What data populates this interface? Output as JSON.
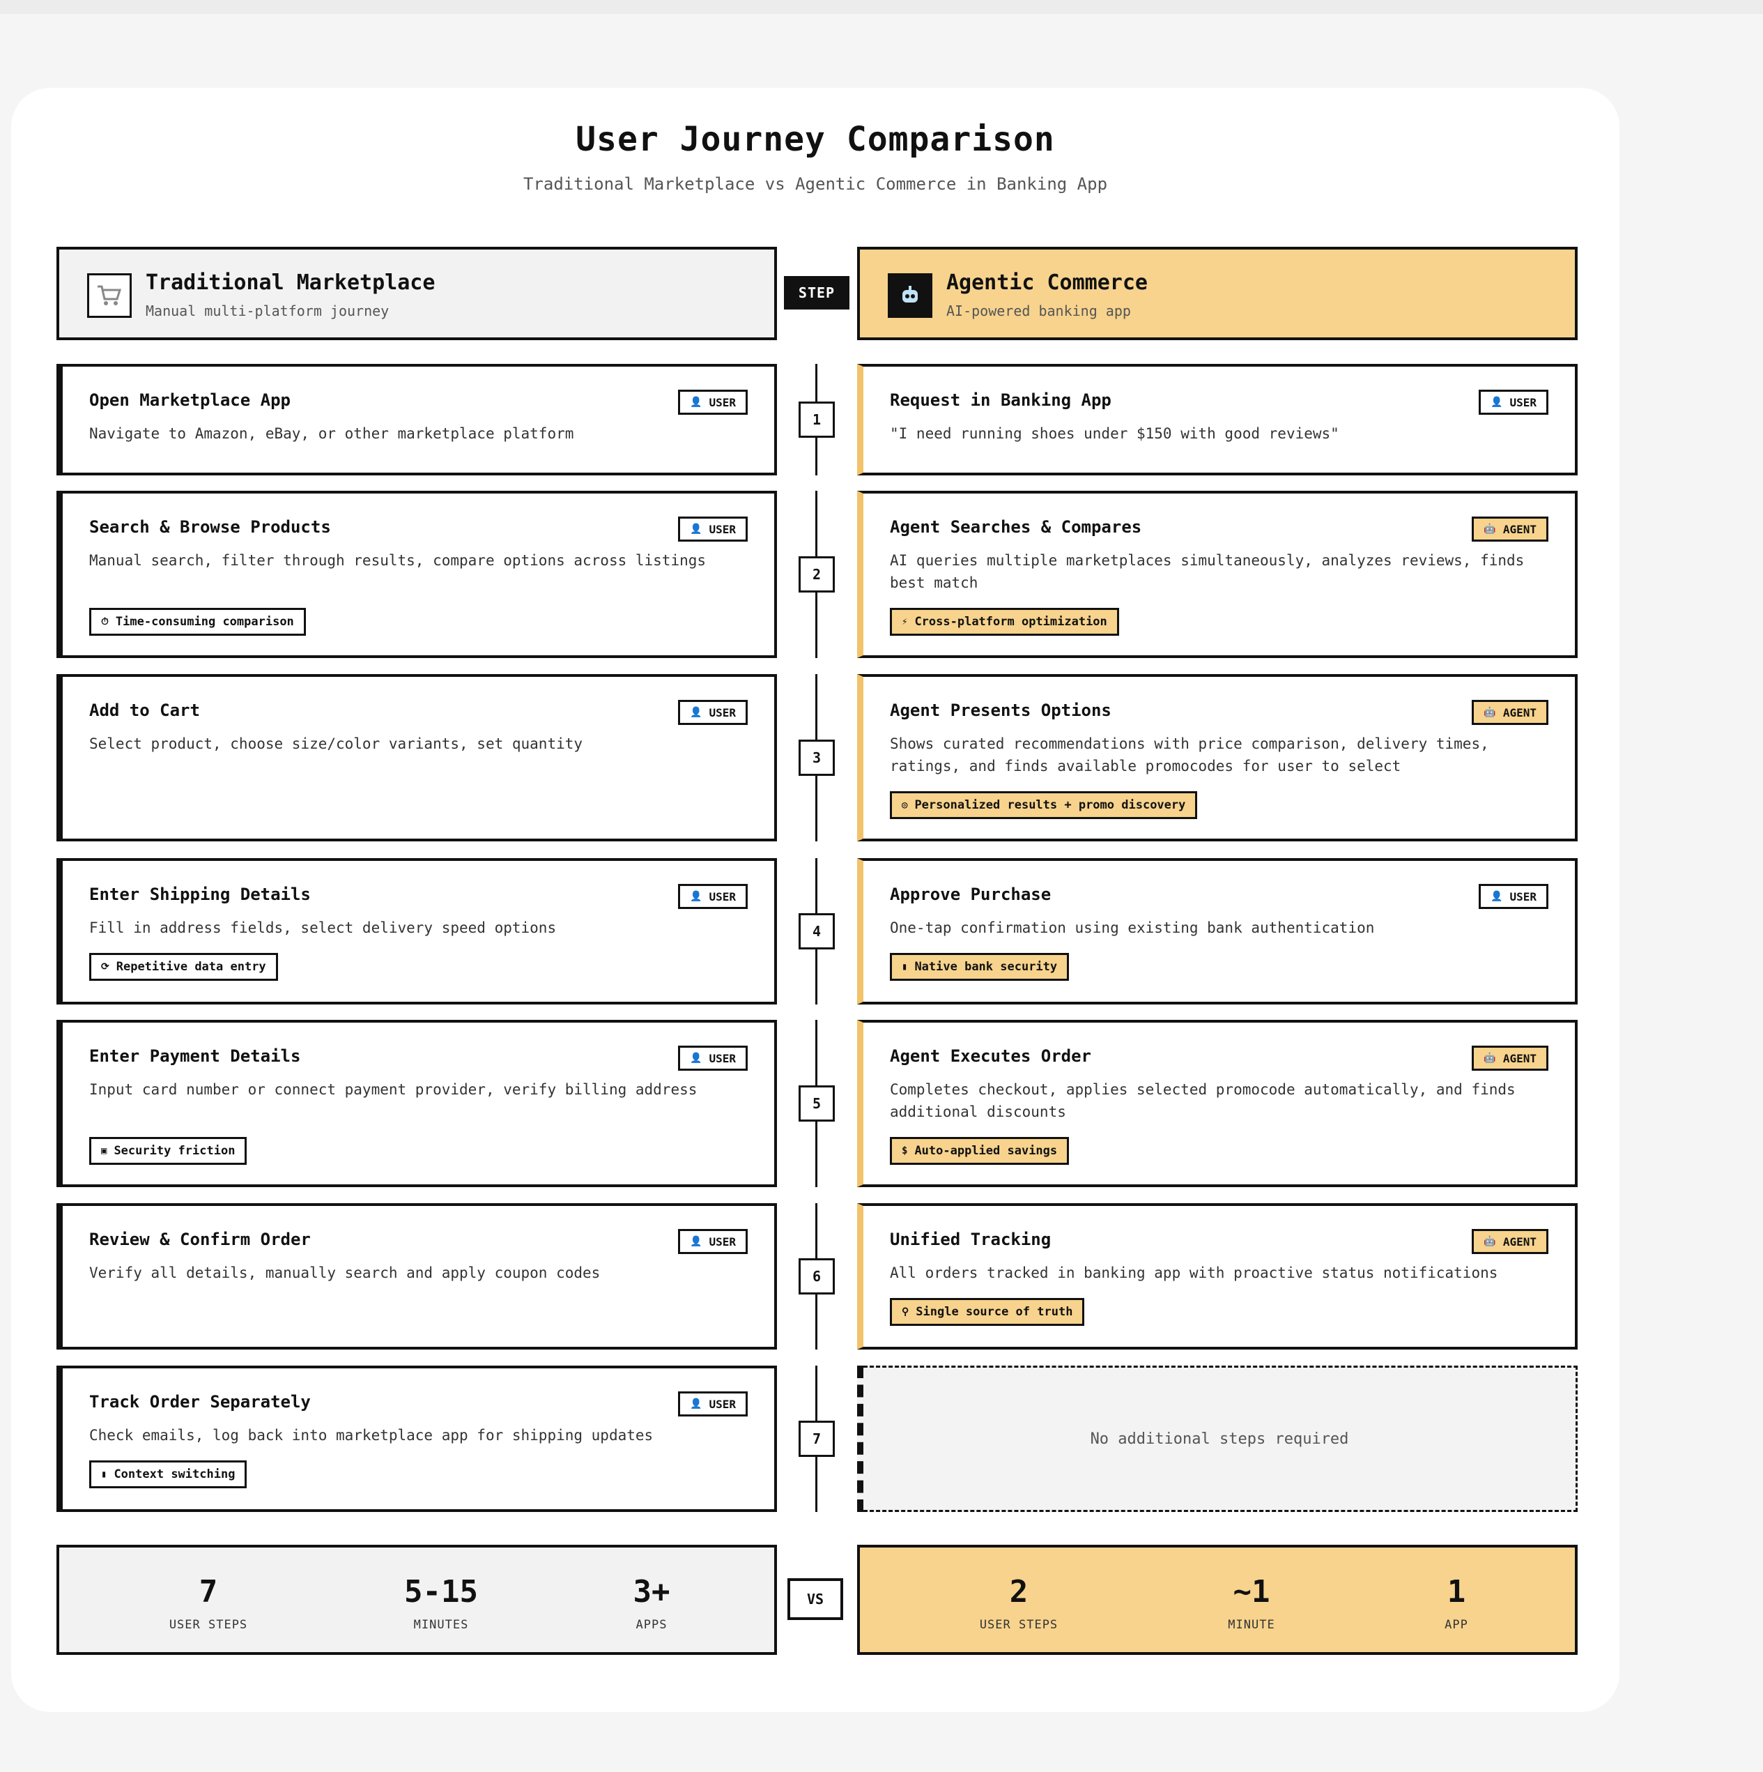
{
  "title": "User Journey Comparison",
  "subtitle": "Traditional Marketplace vs Agentic Commerce in Banking App",
  "step_label": "STEP",
  "vs_label": "VS",
  "colors": {
    "accent": "#f7d38d",
    "accent_border": "#f2c36b",
    "ink": "#111111"
  },
  "traditional": {
    "title": "Traditional Marketplace",
    "subtitle": "Manual multi-platform journey",
    "icon": "cart-icon"
  },
  "agentic": {
    "title": "Agentic Commerce",
    "subtitle": "AI-powered banking app",
    "icon": "robot-icon"
  },
  "badges": {
    "user": "USER",
    "agent": "AGENT"
  },
  "steps": [
    {
      "number": "1",
      "left": {
        "title": "Open Marketplace App",
        "desc": "Navigate to Amazon, eBay, or other marketplace platform",
        "tag": ""
      },
      "right": {
        "title": "Request in Banking App",
        "desc": "\"I need running shoes under $150 with good reviews\"",
        "tag": ""
      }
    },
    {
      "number": "2",
      "left": {
        "title": "Search & Browse Products",
        "desc": "Manual search, filter through results, compare options across listings",
        "tag": "Time-consuming comparison",
        "tag_icon": "⏱"
      },
      "right": {
        "title": "Agent Searches & Compares",
        "desc": "AI queries multiple marketplaces simultaneously, analyzes reviews, finds best match",
        "tag": "Cross-platform optimization",
        "tag_icon": "⚡"
      }
    },
    {
      "number": "3",
      "left": {
        "title": "Add to Cart",
        "desc": "Select product, choose size/color variants, set quantity",
        "tag": ""
      },
      "right": {
        "title": "Agent Presents Options",
        "desc": "Shows curated recommendations with price comparison, delivery times, ratings, and finds available promocodes for user to select",
        "tag": "Personalized results + promo discovery",
        "tag_icon": "◎"
      }
    },
    {
      "number": "4",
      "left": {
        "title": "Enter Shipping Details",
        "desc": "Fill in address fields, select delivery speed options",
        "tag": "Repetitive data entry",
        "tag_icon": "⟳"
      },
      "right": {
        "title": "Approve Purchase",
        "desc": "One-tap confirmation using existing bank authentication",
        "tag": "Native bank security",
        "tag_icon": "▮"
      }
    },
    {
      "number": "5",
      "left": {
        "title": "Enter Payment Details",
        "desc": "Input card number or connect payment provider, verify billing address",
        "tag": "Security friction",
        "tag_icon": "▣"
      },
      "right": {
        "title": "Agent Executes Order",
        "desc": "Completes checkout, applies selected promocode automatically, and finds additional discounts",
        "tag": "Auto-applied savings",
        "tag_icon": "$"
      }
    },
    {
      "number": "6",
      "left": {
        "title": "Review & Confirm Order",
        "desc": "Verify all details, manually search and apply coupon codes",
        "tag": ""
      },
      "right": {
        "title": "Unified Tracking",
        "desc": "All orders tracked in banking app with proactive status notifications",
        "tag": "Single source of truth",
        "tag_icon": "⚲"
      }
    },
    {
      "number": "7",
      "left": {
        "title": "Track Order Separately",
        "desc": "Check emails, log back into marketplace app for shipping updates",
        "tag": "Context switching",
        "tag_icon": "▮"
      },
      "right": {
        "empty_text": "No additional steps required"
      }
    }
  ],
  "stats": {
    "traditional": [
      {
        "value": "7",
        "label": "USER STEPS"
      },
      {
        "value": "5-15",
        "label": "MINUTES"
      },
      {
        "value": "3+",
        "label": "APPS"
      }
    ],
    "agentic": [
      {
        "value": "2",
        "label": "USER STEPS"
      },
      {
        "value": "~1",
        "label": "MINUTE"
      },
      {
        "value": "1",
        "label": "APP"
      }
    ]
  }
}
